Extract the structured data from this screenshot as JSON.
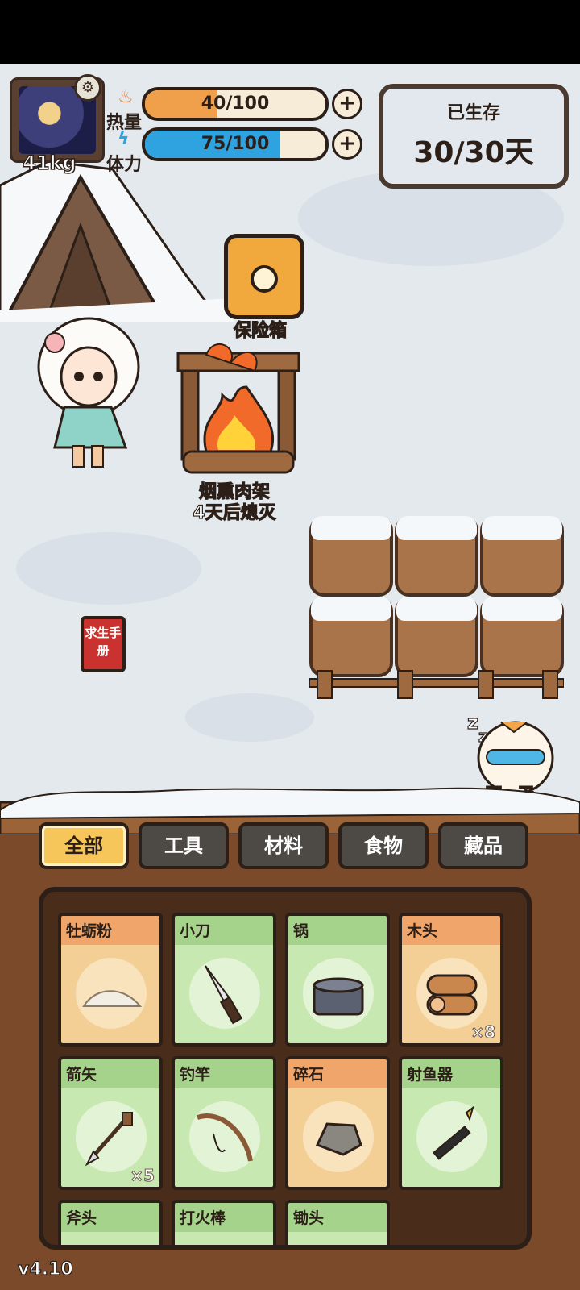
{
  "player": {
    "weight": "41kg"
  },
  "stats": {
    "calories": {
      "label": "热量",
      "text": "40/100",
      "value": 40,
      "max": 100,
      "color": "#f0a04a"
    },
    "stamina": {
      "label": "体力",
      "text": "75/100",
      "value": 75,
      "max": 100,
      "color": "#2fa2e0"
    }
  },
  "survival": {
    "label": "已生存",
    "days": "30/30天"
  },
  "scene": {
    "safe_label": "保险箱",
    "fire_label": "烟熏肉架",
    "fire_status": "4天后熄灭",
    "manual_label": "求生手册",
    "next_day_label": "下一天"
  },
  "tabs": [
    {
      "label": "全部",
      "active": true
    },
    {
      "label": "工具",
      "active": false
    },
    {
      "label": "材料",
      "active": false
    },
    {
      "label": "食物",
      "active": false
    },
    {
      "label": "藏品",
      "active": false
    }
  ],
  "inventory": [
    {
      "name": "牡蛎粉",
      "icon": "oyster-powder-icon",
      "category": "orange",
      "count": ""
    },
    {
      "name": "小刀",
      "icon": "knife-icon",
      "category": "green",
      "count": ""
    },
    {
      "name": "锅",
      "icon": "pot-icon",
      "category": "green",
      "count": ""
    },
    {
      "name": "木头",
      "icon": "wood-log-icon",
      "category": "orange",
      "count": "×8"
    },
    {
      "name": "箭矢",
      "icon": "arrow-icon",
      "category": "green",
      "count": "×5"
    },
    {
      "name": "钓竿",
      "icon": "fishing-rod-icon",
      "category": "green",
      "count": ""
    },
    {
      "name": "碎石",
      "icon": "gravel-icon",
      "category": "orange",
      "count": ""
    },
    {
      "name": "射鱼器",
      "icon": "fish-shooter-icon",
      "category": "green",
      "count": ""
    },
    {
      "name": "斧头",
      "icon": "axe-icon",
      "category": "green",
      "count": ""
    },
    {
      "name": "打火棒",
      "icon": "fire-starter-icon",
      "category": "green",
      "count": ""
    },
    {
      "name": "锄头",
      "icon": "hoe-icon",
      "category": "green",
      "count": ""
    }
  ],
  "version": "v4.10"
}
